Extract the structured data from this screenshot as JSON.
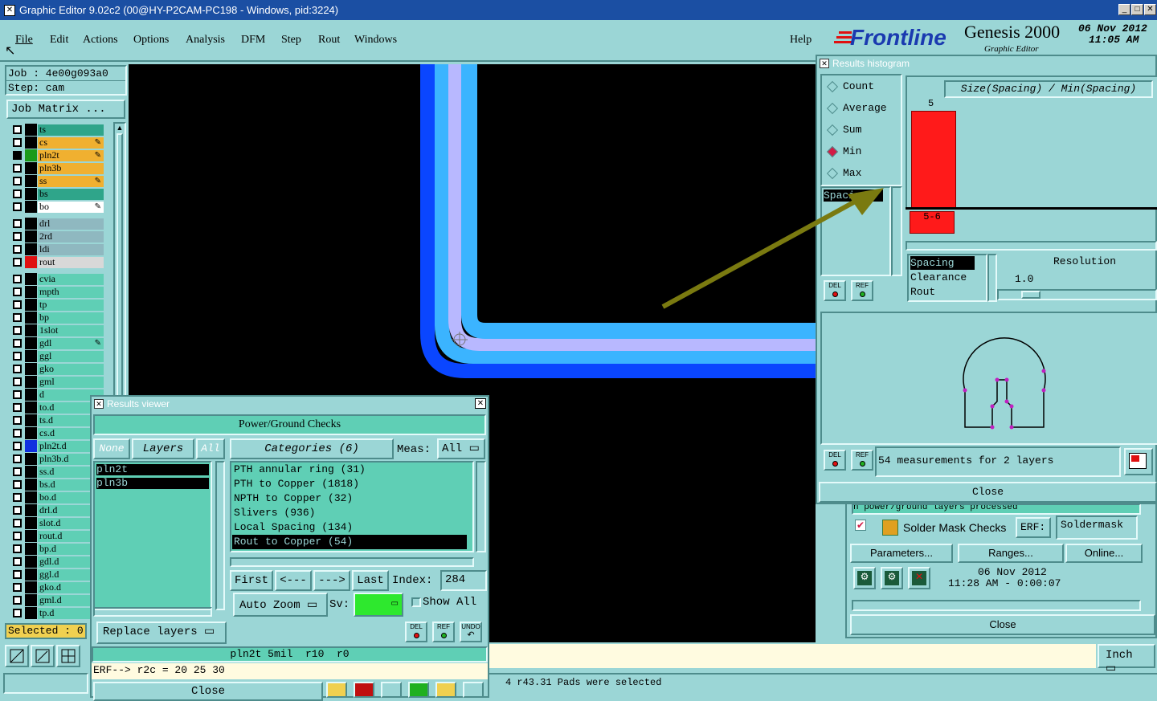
{
  "window": {
    "title": "Graphic Editor 9.02c2 (00@HY-P2CAM-PC198 - Windows, pid:3224)"
  },
  "menu": {
    "items": [
      "File",
      "Edit",
      "Actions",
      "Options",
      "Analysis",
      "DFM",
      "Step",
      "Rout",
      "Windows"
    ],
    "help": "Help"
  },
  "brand": {
    "logo": "Frontline",
    "product": "Genesis 2000",
    "sub": "Graphic Editor",
    "date": "06 Nov 2012",
    "time": "11:05 AM"
  },
  "job": {
    "job_line": "Job : 4e00g093a0",
    "step_line": "Step: cam",
    "matrix_button": "Job Matrix ..."
  },
  "layers_group1": [
    {
      "name": "ts",
      "color": "#2fa58a",
      "active": false,
      "affected": false,
      "swatch": "#000"
    },
    {
      "name": "cs",
      "color": "#f0b030",
      "active": false,
      "affected": true,
      "swatch": "#000"
    },
    {
      "name": "pln2t",
      "color": "#f0b030",
      "active": true,
      "affected": true,
      "swatch": "#1a9a1a"
    },
    {
      "name": "pln3b",
      "color": "#f0b030",
      "active": false,
      "affected": false,
      "swatch": "#000"
    },
    {
      "name": "ss",
      "color": "#f0b030",
      "active": false,
      "affected": true,
      "swatch": "#000"
    },
    {
      "name": "bs",
      "color": "#2fa58a",
      "active": false,
      "affected": false,
      "swatch": "#000"
    },
    {
      "name": "bo",
      "color": "#ffffff",
      "active": false,
      "affected": true,
      "swatch": "#000"
    }
  ],
  "layers_group2": [
    {
      "name": "drl",
      "color": "#8fb8c0",
      "swatch": "#000"
    },
    {
      "name": "2rd",
      "color": "#8fb8c0",
      "swatch": "#000"
    },
    {
      "name": "ldi",
      "color": "#8fb8c0",
      "swatch": "#000"
    },
    {
      "name": "rout",
      "color": "#d8d8d8",
      "swatch": "#e01010"
    }
  ],
  "layers_group3": [
    {
      "name": "cvia",
      "affected": false,
      "swatch": "#000"
    },
    {
      "name": "mpth",
      "affected": false,
      "swatch": "#000"
    },
    {
      "name": "tp",
      "affected": false,
      "swatch": "#000"
    },
    {
      "name": "bp",
      "affected": false,
      "swatch": "#000"
    },
    {
      "name": "1slot",
      "affected": false,
      "swatch": "#000"
    },
    {
      "name": "gdl",
      "affected": true,
      "swatch": "#000"
    },
    {
      "name": "ggl",
      "affected": false,
      "swatch": "#000"
    },
    {
      "name": "gko",
      "affected": false,
      "swatch": "#000"
    },
    {
      "name": "gml",
      "affected": false,
      "swatch": "#000"
    },
    {
      "name": "d",
      "affected": false,
      "swatch": "#000"
    },
    {
      "name": "to.d",
      "affected": false,
      "swatch": "#000"
    },
    {
      "name": "ts.d",
      "affected": false,
      "swatch": "#000"
    },
    {
      "name": "cs.d",
      "affected": false,
      "swatch": "#000"
    },
    {
      "name": "pln2t.d",
      "affected": false,
      "swatch": "#1030e0"
    },
    {
      "name": "pln3b.d",
      "affected": false,
      "swatch": "#000"
    },
    {
      "name": "ss.d",
      "affected": false,
      "swatch": "#000"
    },
    {
      "name": "bs.d",
      "affected": false,
      "swatch": "#000"
    },
    {
      "name": "bo.d",
      "affected": false,
      "swatch": "#000"
    },
    {
      "name": "drl.d",
      "affected": false,
      "swatch": "#000"
    },
    {
      "name": "slot.d",
      "affected": false,
      "swatch": "#000"
    },
    {
      "name": "rout.d",
      "affected": false,
      "swatch": "#000"
    },
    {
      "name": "bp.d",
      "affected": false,
      "swatch": "#000"
    },
    {
      "name": "gdl.d",
      "affected": false,
      "swatch": "#000"
    },
    {
      "name": "ggl.d",
      "affected": false,
      "swatch": "#000"
    },
    {
      "name": "gko.d",
      "affected": false,
      "swatch": "#000"
    },
    {
      "name": "gml.d",
      "affected": false,
      "swatch": "#000"
    },
    {
      "name": "tp.d",
      "affected": false,
      "swatch": "#000"
    }
  ],
  "selected": "Selected : 0",
  "histogram": {
    "title": "Results histogram",
    "modes": [
      {
        "label": "Count",
        "on": false
      },
      {
        "label": "Average",
        "on": false
      },
      {
        "label": "Sum",
        "on": false
      },
      {
        "label": "Min",
        "on": true
      },
      {
        "label": "Max",
        "on": false
      }
    ],
    "spac_item": "Spacing",
    "chart_title": "Size(Spacing) / Min(Spacing)",
    "bar_count": "5",
    "bar_range": "5-6",
    "types": [
      "Spacing",
      "Clearance",
      "Rout"
    ],
    "resolution_label": "Resolution",
    "resolution_value": "1.0",
    "status": "54 measurements for 2 layers",
    "close": "Close",
    "del": "DEL",
    "ref": "REF"
  },
  "checks_panel": {
    "top_text": "n power/ground layers processed",
    "item": "Solder Mask Checks",
    "erf_label": "ERF:",
    "erf_value": "Soldermask",
    "params": "Parameters...",
    "ranges": "Ranges...",
    "online": "Online...",
    "date": "06 Nov 2012",
    "time_line": "11:28 AM - 0:00:07",
    "close": "Close"
  },
  "results_viewer": {
    "title": "Results viewer",
    "heading": "Power/Ground Checks",
    "none": "None",
    "layers": "Layers",
    "all": "All",
    "layer_list": [
      "pln2t",
      "pln3b"
    ],
    "categories_label": "Categories (6)",
    "meas_label": "Meas:",
    "meas_value": "All",
    "categories": [
      {
        "text": "PTH annular ring (31)",
        "sel": false
      },
      {
        "text": "PTH to Copper (1818)",
        "sel": false
      },
      {
        "text": "NPTH to Copper (32)",
        "sel": false
      },
      {
        "text": "Slivers (936)",
        "sel": false
      },
      {
        "text": "Local Spacing (134)",
        "sel": false
      },
      {
        "text": "Rout to Copper (54)",
        "sel": true
      }
    ],
    "first": "First",
    "prev": "<---",
    "next": "--->",
    "last": "Last",
    "index_label": "Index:",
    "index_value": "284",
    "auto_zoom": "Auto Zoom",
    "sv_label": "Sv:",
    "show_all": "Show All",
    "replace_layers": "Replace layers",
    "info_line": "pln2t 5mil  r10  r0",
    "erf_line": "ERF--> r2c = 20 25 30",
    "close": "Close",
    "undo": "UNDO"
  },
  "bottom": {
    "units": "Inch",
    "status": "4 r43.31 Pads were selected"
  },
  "colors": {
    "background": "#9bd6d6",
    "list": "#5fcfb5",
    "canvas": "#000000",
    "bar": "#ff1a1a",
    "arrow": "#7a7a10"
  }
}
